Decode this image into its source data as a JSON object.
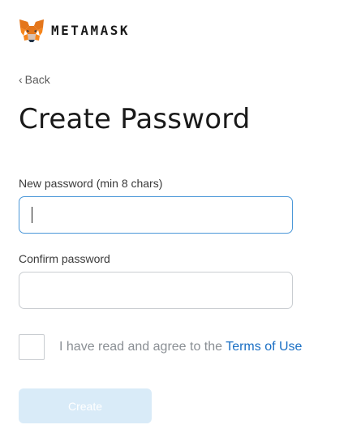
{
  "header": {
    "logo_icon": "metamask-fox-icon",
    "brand_name": "METAMASK"
  },
  "nav": {
    "back_label": "Back",
    "back_icon": "chevron-left-icon"
  },
  "page": {
    "title": "Create Password"
  },
  "form": {
    "new_password": {
      "label": "New password (min 8 chars)",
      "value": "",
      "placeholder": "",
      "focused": true
    },
    "confirm_password": {
      "label": "Confirm password",
      "value": "",
      "placeholder": ""
    },
    "terms": {
      "checked": false,
      "text": "I have read and agree to the",
      "link_text": "Terms of Use"
    },
    "submit": {
      "label": "Create",
      "disabled": true
    }
  },
  "colors": {
    "accent": "#1a6fc4",
    "focus_border": "#4a97d8",
    "disabled_button": "#d9ebf8",
    "fox_orange": "#e2761b"
  }
}
